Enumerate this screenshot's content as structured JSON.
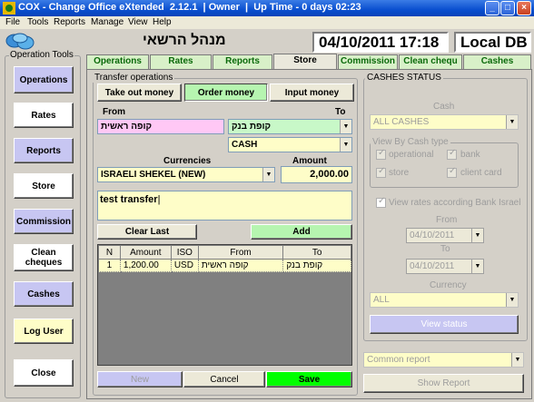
{
  "window": {
    "title": "COX - Change Office eXtended  2.12.1  | Owner  |  Up Time - 0 days 02:23",
    "buttons": [
      "_",
      "□",
      "×"
    ]
  },
  "menu": [
    "File",
    "Tools",
    "Reports",
    "Manage",
    "View",
    "Help"
  ],
  "header": {
    "title": "מנהל הרשאי",
    "datetime": "04/10/2011 17:18",
    "db": "Local DB"
  },
  "operation_tools": {
    "label": "Operation Tools",
    "buttons": [
      "Operations",
      "Rates",
      "Reports",
      "Store",
      "Commission",
      "Clean cheques",
      "Cashes",
      "Log User",
      "Close"
    ]
  },
  "tabs": [
    "Operations",
    "Rates",
    "Reports",
    "Store",
    "Commission",
    "Clean chequ",
    "Cashes"
  ],
  "active_tab": "Store",
  "transfer": {
    "group_label": "Transfer operations",
    "take_out": "Take out money",
    "order": "Order money",
    "input": "Input money",
    "from_label": "From",
    "to_label": "To",
    "from_value": "קופה ראשית",
    "to_value": "קופת בנק",
    "to_type": "CASH",
    "currencies_label": "Currencies",
    "amount_label": "Amount",
    "currency_value": "ISRAELI SHEKEL (NEW)",
    "amount_value": "2,000.00",
    "note": "test transfer",
    "clear_last": "Clear Last",
    "add": "Add",
    "table": {
      "headers": [
        "N",
        "Amount",
        "ISO",
        "From",
        "To"
      ],
      "rows": [
        [
          "1",
          "1,200.00",
          "USD",
          "קופה ראשית",
          "קופת בנק"
        ]
      ]
    },
    "new": "New",
    "cancel": "Cancel",
    "save": "Save"
  },
  "cashes_status": {
    "group_label": "CASHES STATUS",
    "cash_label": "Cash",
    "cash_value": "ALL CASHES",
    "view_by_label": "View By Cash type",
    "cb_operational": "operational",
    "cb_bank": "bank",
    "cb_store": "store",
    "cb_client_card": "client card",
    "rates_bank": "View rates according Bank Israel",
    "from_label": "From",
    "from_date": "04/10/2011",
    "to_label": "To",
    "to_date": "04/10/2011",
    "currency_label": "Currency",
    "currency_value": "ALL",
    "view_status": "View status",
    "report_value": "Common report",
    "show_report": "Show Report"
  },
  "colors": {
    "title_bar": "#0a4fcf",
    "violet_button": "#c7c6f2",
    "green_button": "#00ff00",
    "yellow_field": "#fefdc8",
    "pink_field": "#ffc8f5",
    "green_field": "#c8f8c8",
    "tab_text": "#0a6a0a"
  }
}
